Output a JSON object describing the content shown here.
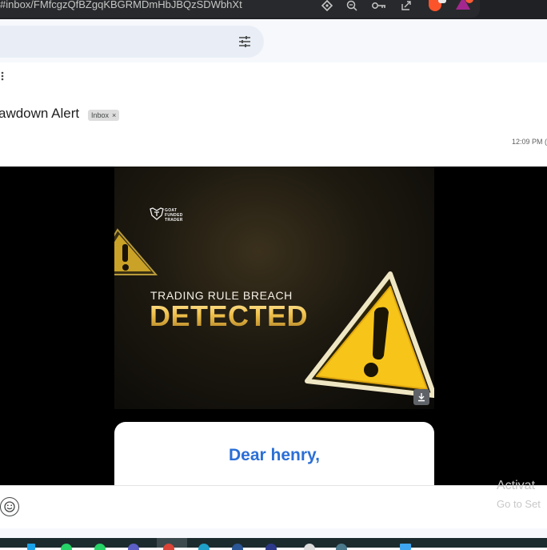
{
  "browser": {
    "url": "#inbox/FMfcgzQfBZgqKBGRMDmHbJBQzSDWbhXt",
    "icons": [
      "extension-icon",
      "zoom-out-icon",
      "password-key-icon",
      "share-icon",
      "brave-shield-icon",
      "brave-rewards-icon"
    ]
  },
  "gmail": {
    "search_icon": "tune-icon",
    "toolbar_icon": "more-vert-icon",
    "subject": "awdown Alert",
    "label_chip": "Inbox",
    "label_chip_close": "×",
    "time": "12:09 PM ("
  },
  "email": {
    "brand_lines": [
      "GOAT",
      "FUNDED",
      "TRADER"
    ],
    "tagline": "TRADING RULE BREACH",
    "headline": "DETECTED",
    "greeting": "Dear henry,",
    "accent_color": "#2b6fd6",
    "warning_color": "#f7c51a"
  },
  "composer": {
    "emoji_icon": "emoji-icon"
  },
  "overlay": {
    "activate_title": "Activat",
    "activate_sub": "Go to Set"
  },
  "taskbar": {
    "icons": [
      "windows-icon",
      "whatsapp-icon",
      "whatsapp-business-icon",
      "app-icon",
      "chrome-icon",
      "edge-icon",
      "app-icon",
      "chrome-dev-icon",
      "app-icon",
      "app-icon"
    ]
  }
}
